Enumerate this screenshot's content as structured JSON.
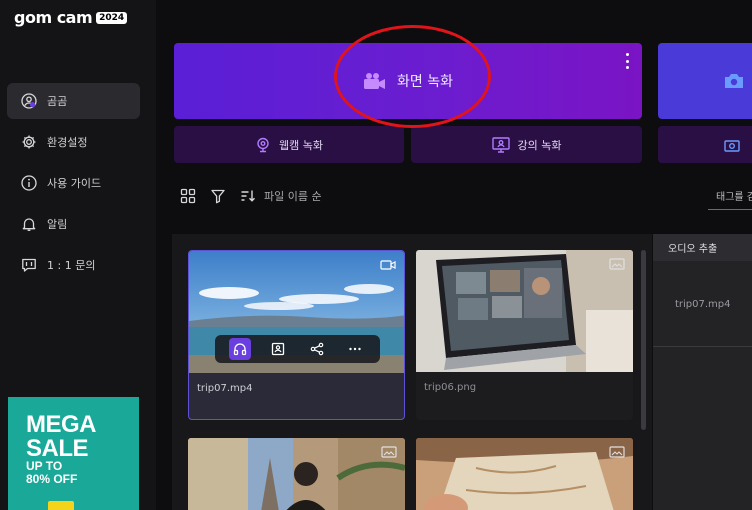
{
  "app": {
    "brand": "gom cam",
    "year_badge": "2024"
  },
  "sidebar": {
    "items": [
      {
        "label": "곰곰",
        "icon": "user-circle-icon",
        "active": true
      },
      {
        "label": "환경설정",
        "icon": "gear-icon",
        "active": false
      },
      {
        "label": "사용 가이드",
        "icon": "info-icon",
        "active": false
      },
      {
        "label": "알림",
        "icon": "bell-icon",
        "active": false
      },
      {
        "label": "1 : 1 문의",
        "icon": "chat-icon",
        "active": false
      }
    ],
    "promo": {
      "line1": "MEGA",
      "line2": "SALE",
      "line3": "UP TO",
      "line4": "80% OFF"
    }
  },
  "modes": {
    "screen_record": "화면 녹화",
    "webcam_record": "웹캠 녹화",
    "lecture_record": "강의 녹화"
  },
  "toolbar": {
    "sort_label": "파일 이름 순",
    "tag_search_placeholder": "태그를 검"
  },
  "files": [
    {
      "name": "trip07.mp4",
      "type": "video",
      "selected": true
    },
    {
      "name": "trip06.png",
      "type": "image",
      "selected": false
    },
    {
      "name": "",
      "type": "image",
      "selected": false
    },
    {
      "name": "",
      "type": "image",
      "selected": false
    }
  ],
  "side_panel": {
    "title": "오디오 추출",
    "file": "trip07.mp4"
  },
  "colors": {
    "accent": "#6a3fe0",
    "annotation": "#e0141a",
    "promo": "#1aa898"
  }
}
